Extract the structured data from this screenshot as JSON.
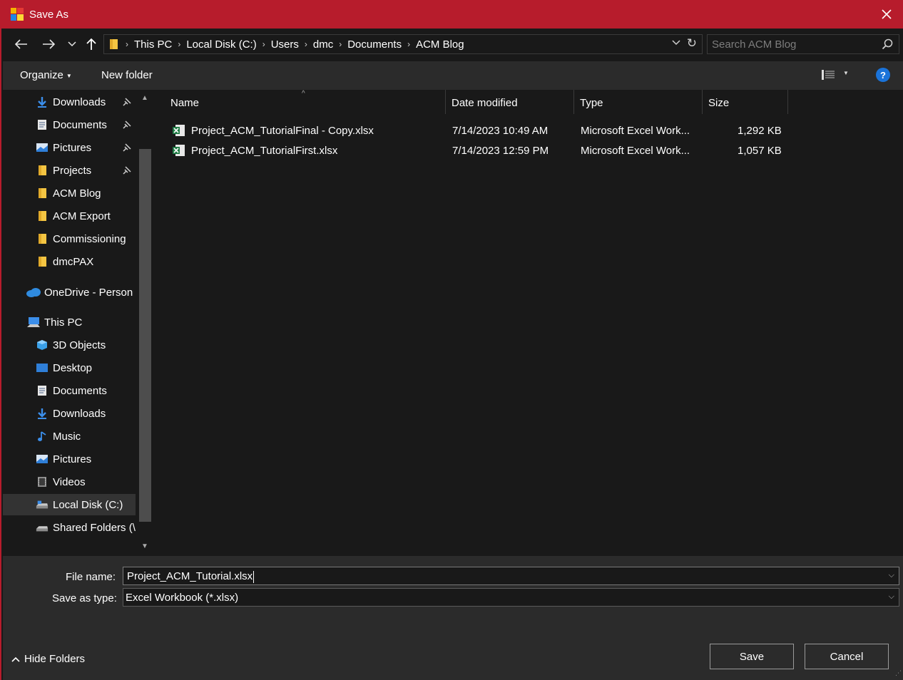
{
  "window": {
    "title": "Save As",
    "accent": "#b71c2c"
  },
  "address": {
    "crumbs": [
      "This PC",
      "Local Disk (C:)",
      "Users",
      "dmc",
      "Documents",
      "ACM Blog"
    ]
  },
  "search": {
    "placeholder": "Search ACM Blog"
  },
  "toolbar": {
    "organize_label": "Organize",
    "new_folder_label": "New folder",
    "help_label": "?"
  },
  "sidebar": {
    "items": [
      {
        "label": "Downloads",
        "icon": "download-arrow-icon",
        "pinned": true
      },
      {
        "label": "Documents",
        "icon": "document-icon",
        "pinned": true
      },
      {
        "label": "Pictures",
        "icon": "pictures-icon",
        "pinned": true
      },
      {
        "label": "Projects",
        "icon": "folder-icon",
        "pinned": true
      },
      {
        "label": "ACM Blog",
        "icon": "folder-icon",
        "pinned": false
      },
      {
        "label": "ACM Export",
        "icon": "folder-icon",
        "pinned": false
      },
      {
        "label": "Commissioning",
        "icon": "folder-icon",
        "pinned": false
      },
      {
        "label": "dmcPAX",
        "icon": "folder-icon",
        "pinned": false
      },
      {
        "label": "OneDrive - Person",
        "icon": "onedrive-icon",
        "pinned": false
      },
      {
        "label": "This PC",
        "icon": "this-pc-icon",
        "pinned": false
      },
      {
        "label": "3D Objects",
        "icon": "3d-objects-icon",
        "pinned": false
      },
      {
        "label": "Desktop",
        "icon": "desktop-icon",
        "pinned": false
      },
      {
        "label": "Documents",
        "icon": "document-icon",
        "pinned": false
      },
      {
        "label": "Downloads",
        "icon": "download-arrow-icon",
        "pinned": false
      },
      {
        "label": "Music",
        "icon": "music-icon",
        "pinned": false
      },
      {
        "label": "Pictures",
        "icon": "pictures-icon",
        "pinned": false
      },
      {
        "label": "Videos",
        "icon": "videos-icon",
        "pinned": false
      },
      {
        "label": "Local Disk (C:)",
        "icon": "drive-icon",
        "pinned": false,
        "selected": true
      },
      {
        "label": "Shared Folders (\\",
        "icon": "network-drive-icon",
        "pinned": false
      }
    ]
  },
  "columns": {
    "name": "Name",
    "date": "Date modified",
    "type": "Type",
    "size": "Size"
  },
  "files": [
    {
      "name": "Project_ACM_TutorialFinal - Copy.xlsx",
      "date": "7/14/2023 10:49 AM",
      "type": "Microsoft Excel Work...",
      "size": "1,292 KB"
    },
    {
      "name": "Project_ACM_TutorialFirst.xlsx",
      "date": "7/14/2023 12:59 PM",
      "type": "Microsoft Excel Work...",
      "size": "1,057 KB"
    }
  ],
  "form": {
    "file_name_label": "File name:",
    "file_name_value": "Project_ACM_Tutorial.xlsx",
    "save_type_label": "Save as type:",
    "save_type_value": "Excel Workbook (*.xlsx)"
  },
  "footer": {
    "hide_folders_label": "Hide Folders",
    "save_label": "Save",
    "cancel_label": "Cancel"
  }
}
